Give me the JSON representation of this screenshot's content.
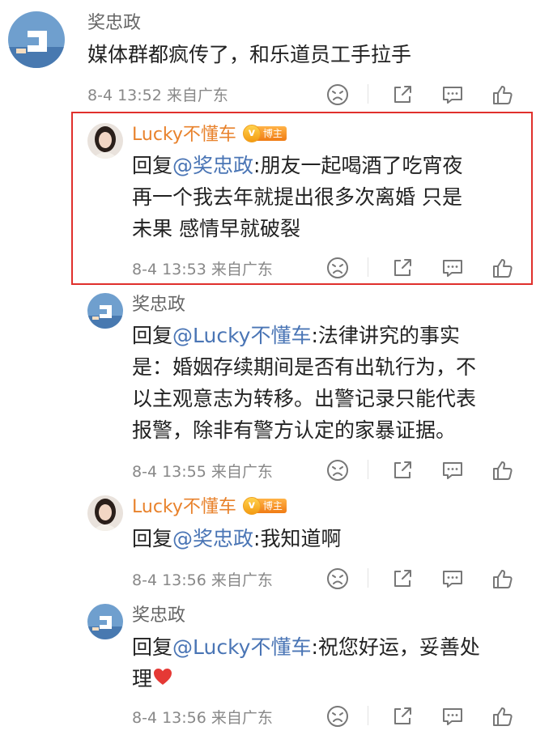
{
  "comments": [
    {
      "id": "c0",
      "author": "奖忠政",
      "author_color": "gray",
      "reply_prefix": "",
      "mention": "",
      "body": "媒体群都疯传了，和乐道员工手拉手",
      "meta": "8-4 13:52 来自广东",
      "icons": [
        "dislike-icon",
        "share-icon",
        "comment-icon",
        "like-icon"
      ]
    },
    {
      "id": "c1",
      "author": "Lucky不懂车",
      "author_color": "orange",
      "badge": {
        "v": "v",
        "label": "博主"
      },
      "reply_prefix": "回复",
      "mention": "@奖忠政",
      "body": ":朋友一起喝酒了吃宵夜",
      "body_lines": [
        "再一个我去年就提出很多次离婚 只是",
        "未果 感情早就破裂"
      ],
      "meta": "8-4 13:53 来自广东",
      "highlighted": true
    },
    {
      "id": "c2",
      "author": "奖忠政",
      "author_color": "gray",
      "reply_prefix": "回复",
      "mention": "@Lucky不懂车",
      "body": ":法律讲究的事实",
      "body_lines": [
        "是：婚姻存续期间是否有出轨行为，不",
        "以主观意志为转移。出警记录只能代表",
        "报警，除非有警方认定的家暴证据。"
      ],
      "meta": "8-4 13:55 来自广东"
    },
    {
      "id": "c3",
      "author": "Lucky不懂车",
      "author_color": "orange",
      "badge": {
        "v": "v",
        "label": "博主"
      },
      "reply_prefix": "回复",
      "mention": "@奖忠政",
      "body": ":我知道啊",
      "meta": "8-4 13:56 来自广东"
    },
    {
      "id": "c4",
      "author": "奖忠政",
      "author_color": "gray",
      "reply_prefix": "回复",
      "mention": "@Lucky不懂车",
      "body": ":祝您好运，妥善处",
      "body_lines": [
        "理"
      ],
      "emoji": "heart-emoji",
      "meta": "8-4 13:56 来自广东"
    }
  ],
  "colors": {
    "mention": "#4a75b5",
    "author_orange": "#e8822c",
    "highlight_border": "#e0302c",
    "meta_gray": "#888888"
  }
}
